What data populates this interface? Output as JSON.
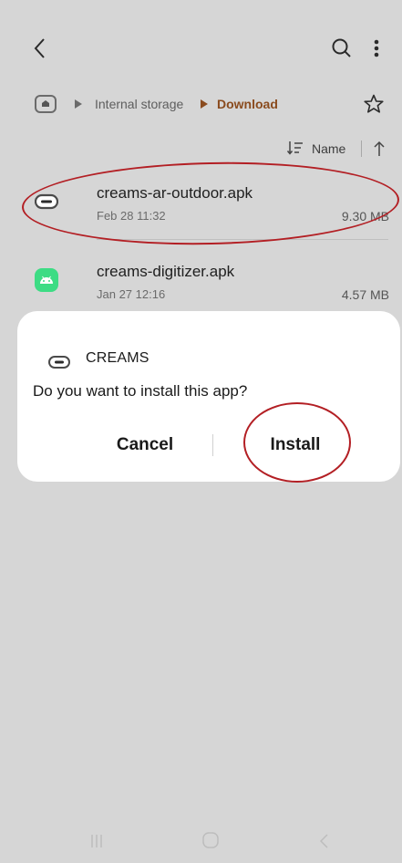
{
  "breadcrumb": {
    "home_icon": "home-icon",
    "items": [
      "Internal storage",
      "Download"
    ]
  },
  "sort": {
    "label": "Name",
    "direction_icon": "arrow-up-icon"
  },
  "files": [
    {
      "name": "creams-ar-outdoor.apk",
      "date": "Feb 28 11:32",
      "size": "9.30 MB",
      "icon": "creams-app-icon"
    },
    {
      "name": "creams-digitizer.apk",
      "date": "Jan 27 12:16",
      "size": "4.57 MB",
      "icon": "android-icon"
    }
  ],
  "dialog": {
    "app_name": "CREAMS",
    "question": "Do you want to install this app?",
    "cancel_label": "Cancel",
    "install_label": "Install"
  },
  "colors": {
    "background": "#d6d6d6",
    "accent_breadcrumb": "#8a4b1e",
    "annotation_red": "#b31f24",
    "android_green": "#3ddc84"
  }
}
